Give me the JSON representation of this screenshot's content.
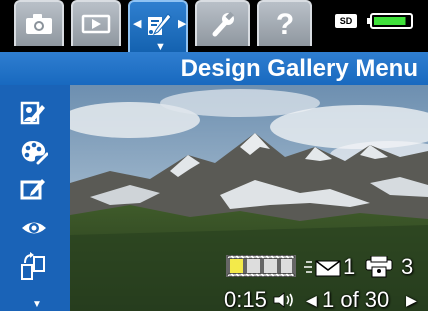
{
  "tabs": [
    {
      "name": "capture",
      "icon": "camera-icon",
      "active": false
    },
    {
      "name": "review",
      "icon": "play-icon",
      "active": false
    },
    {
      "name": "design-gallery",
      "icon": "design-gallery-icon",
      "active": true
    },
    {
      "name": "setup",
      "icon": "wrench-icon",
      "active": false
    },
    {
      "name": "help",
      "icon": "question-icon",
      "active": false
    }
  ],
  "status": {
    "storage_label": "SD",
    "battery_level": 0.9,
    "battery_color": "#3fe03a"
  },
  "header": {
    "title": "Design Gallery Menu"
  },
  "sidebar": {
    "items": [
      {
        "icon": "edit-photo-icon"
      },
      {
        "icon": "artistic-effects-icon"
      },
      {
        "icon": "add-border-icon"
      },
      {
        "icon": "red-eye-icon"
      },
      {
        "icon": "rotate-icon"
      }
    ],
    "more_indicator": "▼"
  },
  "overlay": {
    "email_count": "1",
    "print_count": "3",
    "duration": "0:15",
    "position": "1 of 30"
  },
  "colors": {
    "active_tab": "#1a6ec2",
    "title_bar": "#1f6fc4",
    "sidebar": "#1a63b7",
    "thumb_highlight": "#f3ea4a"
  }
}
